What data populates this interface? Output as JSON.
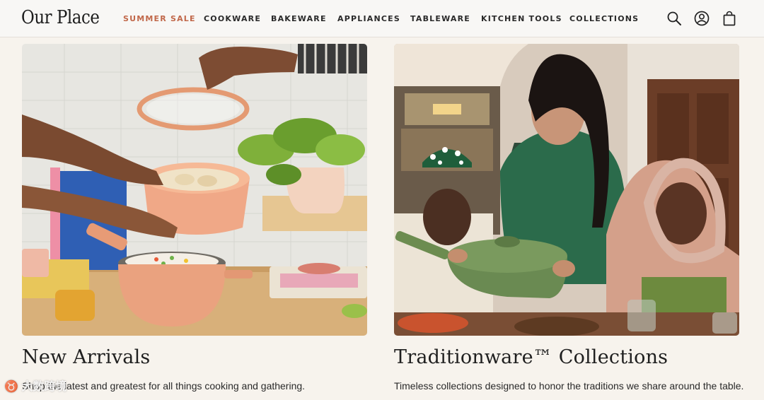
{
  "header": {
    "logo": "Our Place",
    "nav": [
      {
        "label": "SUMMER SALE",
        "name": "nav-summer-sale"
      },
      {
        "label": "COOKWARE",
        "name": "nav-cookware"
      },
      {
        "label": "BAKEWARE",
        "name": "nav-bakeware"
      },
      {
        "label": "APPLIANCES",
        "name": "nav-appliances"
      },
      {
        "label": "TABLEWARE",
        "name": "nav-tableware"
      },
      {
        "label": "KITCHEN TOOLS",
        "name": "nav-kitchen-tools"
      },
      {
        "label": "COLLECTIONS",
        "name": "nav-collections"
      }
    ],
    "icons": [
      "search-icon",
      "account-icon",
      "cart-icon"
    ]
  },
  "cards": [
    {
      "title": "New Arrivals",
      "desc": "Shop the latest and greatest for all things cooking and gathering."
    },
    {
      "title": "Traditionware™ Collections",
      "desc": "Timeless collections designed to honor the traditions we share around the table."
    }
  ],
  "watermark": "♉ 大数跨境",
  "colors": {
    "accent_sale": "#c1684a",
    "background": "#f7f3ed",
    "header_bg": "#f8f7f5"
  }
}
